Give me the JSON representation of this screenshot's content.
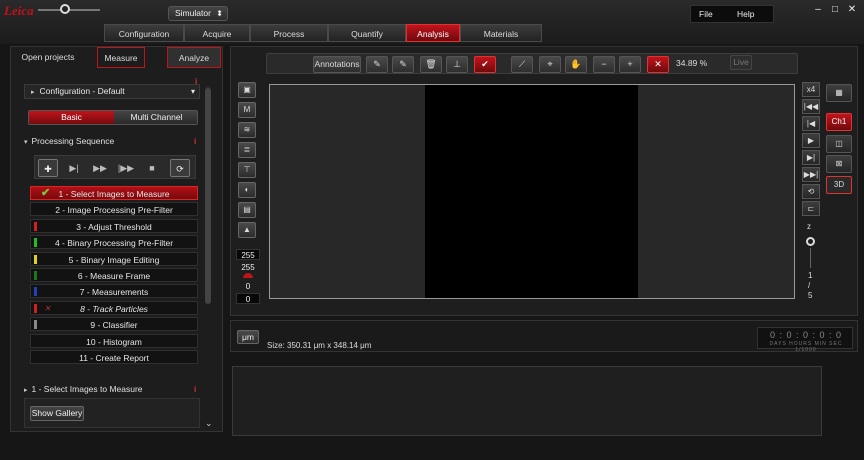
{
  "app": {
    "logo_text": "Leica",
    "simulator": "Simulator"
  },
  "menu": {
    "file": "File",
    "help": "Help"
  },
  "window_controls": {
    "minimize": "–",
    "maximize": "□",
    "close": "✕"
  },
  "workflow_tabs": [
    "Configuration",
    "Acquire",
    "Process",
    "Quantify",
    "Analysis",
    "Materials"
  ],
  "active_workflow_tab": "Analysis",
  "left_tabs": [
    "Open projects",
    "Measure",
    "Analyze"
  ],
  "config": {
    "header": "Configuration - Default",
    "basic": "Basic",
    "multi": "Multi Channel"
  },
  "processing": {
    "header": "Processing Sequence"
  },
  "sequence": [
    {
      "label": "1 - Select Images to Measure",
      "color": "",
      "active": true,
      "check": "✔"
    },
    {
      "label": "2 - Image Processing Pre-Filter",
      "color": ""
    },
    {
      "label": "3 - Adjust Threshold",
      "color": "#d02020"
    },
    {
      "label": "4 - Binary Processing Pre-Filter",
      "color": "#20c020"
    },
    {
      "label": "5 - Binary Image Editing",
      "color": "#e0d020"
    },
    {
      "label": "6 - Measure Frame",
      "color": "#1a7a1a"
    },
    {
      "label": "7 - Measurements",
      "color": "#2040c0"
    },
    {
      "label": "8 - Track Particles",
      "color": "#d02020",
      "italic": true,
      "xmark": "✕"
    },
    {
      "label": "9 - Classifier",
      "color": "#888888"
    },
    {
      "label": "10 - Histogram",
      "color": ""
    },
    {
      "label": "11 - Create Report",
      "color": ""
    }
  ],
  "step_section": {
    "header": "1 - Select Images to Measure",
    "gallery_button": "Show Gallery"
  },
  "view_toolbar": {
    "annotations": "Annotations",
    "zoom": "34.89 %",
    "live": "Live"
  },
  "levels": {
    "v1": "255",
    "v2": "255",
    "v3": "0",
    "v4": "0"
  },
  "right_strip": {
    "x4": "x4",
    "z": "z",
    "pos_top": "1",
    "pos_sep": "/",
    "pos_bottom": "5"
  },
  "channel": {
    "ch1": "Ch1",
    "mode3d": "3D"
  },
  "info": {
    "unit": "μm",
    "size": "Size: 350.31 μm x 348.14 μm"
  },
  "timer": {
    "digits": "0 : 0 : 0 : 0 : 0",
    "labels": "DAYS  HOURS  MIN  SEC  1/1000"
  },
  "colors": {
    "accent": "#c0141b",
    "check": "#7ac943"
  }
}
